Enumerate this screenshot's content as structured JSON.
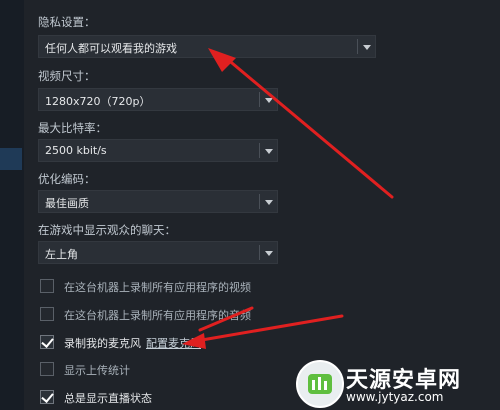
{
  "privacy": {
    "label": "隐私设置：",
    "value": "任何人都可以观看我的游戏"
  },
  "video_size": {
    "label": "视频尺寸：",
    "value": "1280x720（720p）"
  },
  "max_bitrate": {
    "label": "最大比特率：",
    "value": "2500 kbit/s"
  },
  "encoding": {
    "label": "优化编码：",
    "value": "最佳画质"
  },
  "chat_position": {
    "label": "在游戏中显示观众的聊天：",
    "value": "左上角"
  },
  "checkboxes": [
    {
      "label": "在这台机器上录制所有应用程序的视频",
      "checked": false
    },
    {
      "label": "在这台机器上录制所有应用程序的音频",
      "checked": false
    },
    {
      "label": "录制我的麦克风",
      "checked": true,
      "link": "配置麦克风"
    },
    {
      "label": "显示上传统计",
      "checked": false
    },
    {
      "label": "总是显示直播状态",
      "checked": true
    }
  ],
  "annotation_color": "#e02020",
  "watermark": {
    "title": "天源安卓网",
    "url": "www.jytyaz.com"
  }
}
